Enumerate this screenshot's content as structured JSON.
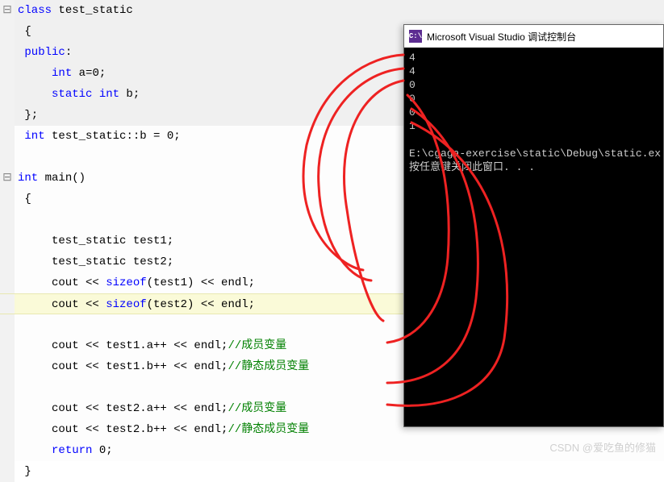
{
  "code": {
    "lines": [
      {
        "fold": "⊟",
        "bg": "hl",
        "tokens": [
          {
            "t": "kw",
            "v": "class"
          },
          {
            "t": "op",
            "v": " "
          },
          {
            "t": "ident",
            "v": "test_static"
          }
        ]
      },
      {
        "bg": "hl",
        "tokens": [
          {
            "t": "op",
            "v": " {"
          }
        ]
      },
      {
        "bg": "hl",
        "tokens": [
          {
            "t": "kw",
            "v": " public"
          },
          {
            "t": "op",
            "v": ":"
          }
        ]
      },
      {
        "bg": "hl",
        "tokens": [
          {
            "t": "op",
            "v": "     "
          },
          {
            "t": "kw",
            "v": "int"
          },
          {
            "t": "op",
            "v": " a=0;"
          }
        ]
      },
      {
        "bg": "hl",
        "tokens": [
          {
            "t": "op",
            "v": "     "
          },
          {
            "t": "kw",
            "v": "static int"
          },
          {
            "t": "op",
            "v": " b;"
          }
        ]
      },
      {
        "bg": "hl",
        "tokens": [
          {
            "t": "op",
            "v": " };"
          }
        ]
      },
      {
        "tokens": [
          {
            "t": "op",
            "v": " "
          },
          {
            "t": "kw",
            "v": "int"
          },
          {
            "t": "op",
            "v": " test_static::b = 0;"
          }
        ]
      },
      {
        "tokens": [
          {
            "t": "op",
            "v": ""
          }
        ]
      },
      {
        "fold": "⊟",
        "tokens": [
          {
            "t": "kw",
            "v": "int"
          },
          {
            "t": "op",
            "v": " "
          },
          {
            "t": "ident",
            "v": "main"
          },
          {
            "t": "op",
            "v": "()"
          }
        ]
      },
      {
        "tokens": [
          {
            "t": "op",
            "v": " {"
          }
        ]
      },
      {
        "tokens": [
          {
            "t": "op",
            "v": ""
          }
        ]
      },
      {
        "tokens": [
          {
            "t": "op",
            "v": "     test_static test1;"
          }
        ]
      },
      {
        "tokens": [
          {
            "t": "op",
            "v": "     test_static test2;"
          }
        ]
      },
      {
        "tokens": [
          {
            "t": "op",
            "v": "     cout << "
          },
          {
            "t": "func",
            "v": "sizeof"
          },
          {
            "t": "op",
            "v": "(test1) << endl;"
          }
        ]
      },
      {
        "bg": "cursor",
        "tokens": [
          {
            "t": "op",
            "v": "     cout << "
          },
          {
            "t": "func",
            "v": "sizeof"
          },
          {
            "t": "op",
            "v": "(test2) << endl;"
          }
        ]
      },
      {
        "tokens": [
          {
            "t": "op",
            "v": ""
          }
        ]
      },
      {
        "tokens": [
          {
            "t": "op",
            "v": "     cout << test1.a++ << endl;"
          },
          {
            "t": "comment",
            "v": "//成员变量"
          }
        ]
      },
      {
        "tokens": [
          {
            "t": "op",
            "v": "     cout << test1.b++ << endl;"
          },
          {
            "t": "comment",
            "v": "//静态成员变量"
          }
        ]
      },
      {
        "tokens": [
          {
            "t": "op",
            "v": ""
          }
        ]
      },
      {
        "tokens": [
          {
            "t": "op",
            "v": "     cout << test2.a++ << endl;"
          },
          {
            "t": "comment",
            "v": "//成员变量"
          }
        ]
      },
      {
        "tokens": [
          {
            "t": "op",
            "v": "     cout << test2.b++ << endl;"
          },
          {
            "t": "comment",
            "v": "//静态成员变量"
          }
        ]
      },
      {
        "tokens": [
          {
            "t": "op",
            "v": "     "
          },
          {
            "t": "kw",
            "v": "return"
          },
          {
            "t": "op",
            "v": " 0;"
          }
        ]
      },
      {
        "tokens": [
          {
            "t": "op",
            "v": " }"
          }
        ]
      }
    ]
  },
  "console": {
    "icon_text": "C:\\",
    "title": "Microsoft Visual Studio 调试控制台",
    "output": [
      "4",
      "4",
      "0",
      "0",
      "0",
      "1",
      "",
      "E:\\cgaga-exercise\\static\\Debug\\static.ex",
      "按任意键关闭此窗口. . ."
    ]
  },
  "watermark": "CSDN @爱吃鱼的修猫"
}
